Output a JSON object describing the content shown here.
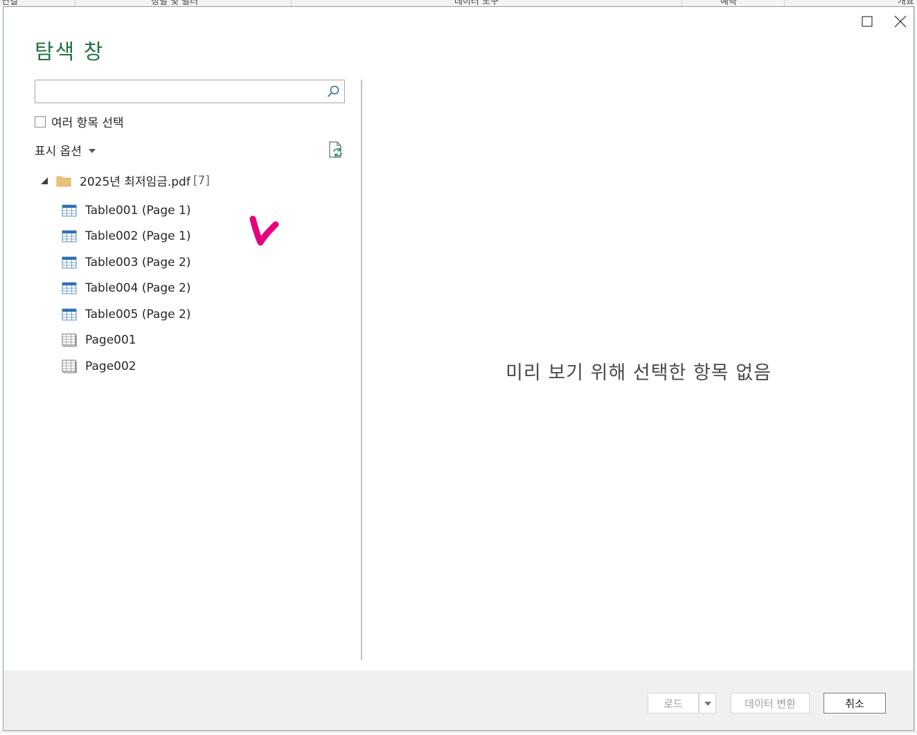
{
  "background": {
    "ribbon_fragments": [
      "연결",
      "정렬 및 필터",
      "데이터 도구",
      "예측",
      "개요"
    ]
  },
  "dialog": {
    "title": "탐색 창",
    "window_controls": [
      "maximize-icon",
      "close-icon"
    ],
    "search": {
      "value": "",
      "placeholder": ""
    },
    "multi_select_label": "여러 항목 선택",
    "multi_select_checked": false,
    "display_options_label": "표시 옵션",
    "tree": {
      "root": {
        "name": "2025년 최저임금.pdf",
        "count": "[7]",
        "expanded": true
      },
      "items": [
        {
          "label": "Table001 (Page 1)",
          "icon": "table-icon"
        },
        {
          "label": "Table002 (Page 1)",
          "icon": "table-icon"
        },
        {
          "label": "Table003 (Page 2)",
          "icon": "table-icon"
        },
        {
          "label": "Table004 (Page 2)",
          "icon": "table-icon"
        },
        {
          "label": "Table005 (Page 2)",
          "icon": "table-icon"
        },
        {
          "label": "Page001",
          "icon": "page-icon"
        },
        {
          "label": "Page002",
          "icon": "page-icon"
        }
      ]
    },
    "preview_empty_message": "미리 보기 위해 선택한 항목 없음",
    "footer": {
      "load_label": "로드",
      "transform_label": "데이터 변환",
      "cancel_label": "취소"
    },
    "colors": {
      "title_green": "#217346",
      "annotation_magenta": "#e6007e",
      "table_icon_blue": "#2e6fb5"
    }
  }
}
